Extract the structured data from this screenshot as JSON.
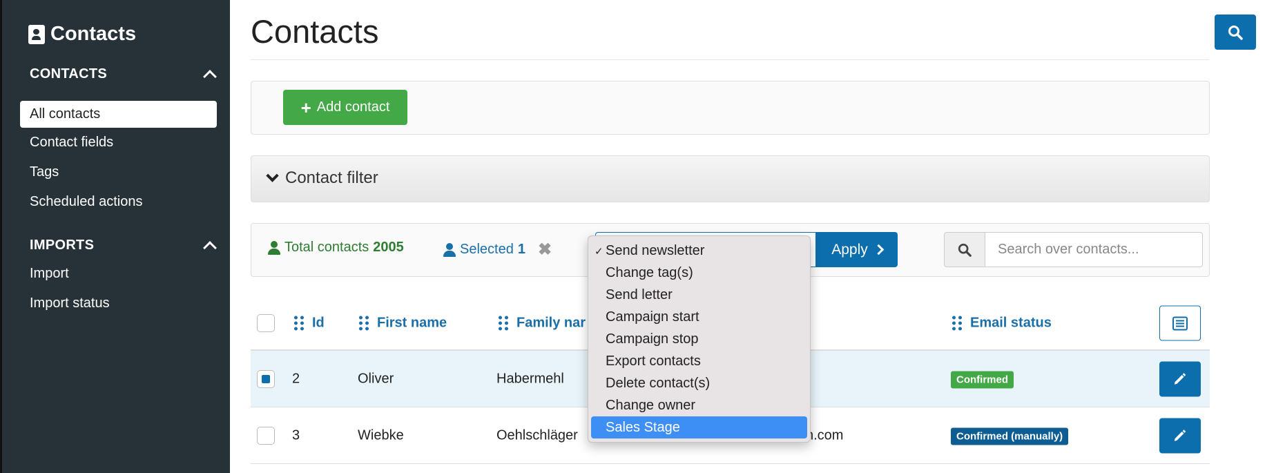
{
  "app": {
    "brand": "Contacts",
    "page_title": "Contacts"
  },
  "sidebar": {
    "sections": [
      {
        "title": "CONTACTS",
        "items": [
          {
            "label": "All contacts",
            "active": true
          },
          {
            "label": "Contact fields",
            "active": false
          },
          {
            "label": "Tags",
            "active": false
          },
          {
            "label": "Scheduled actions",
            "active": false
          }
        ]
      },
      {
        "title": "IMPORTS",
        "items": [
          {
            "label": "Import",
            "active": false
          },
          {
            "label": "Import status",
            "active": false
          }
        ]
      }
    ]
  },
  "toolbar": {
    "add_label": "Add contact",
    "filter_label": "Contact filter"
  },
  "stats": {
    "total_label": "Total contacts",
    "total_value": "2005",
    "selected_label": "Selected",
    "selected_value": "1",
    "clear_glyph": "✖"
  },
  "actions": {
    "apply_label": "Apply",
    "options": [
      {
        "label": "Send newsletter",
        "checked": true,
        "highlighted": false
      },
      {
        "label": "Change tag(s)",
        "checked": false,
        "highlighted": false
      },
      {
        "label": "Send letter",
        "checked": false,
        "highlighted": false
      },
      {
        "label": "Campaign start",
        "checked": false,
        "highlighted": false
      },
      {
        "label": "Campaign stop",
        "checked": false,
        "highlighted": false
      },
      {
        "label": "Export contacts",
        "checked": false,
        "highlighted": false
      },
      {
        "label": "Delete contact(s)",
        "checked": false,
        "highlighted": false
      },
      {
        "label": "Change owner",
        "checked": false,
        "highlighted": false
      },
      {
        "label": "Sales Stage",
        "checked": false,
        "highlighted": true
      }
    ],
    "check_glyph": "✓"
  },
  "search": {
    "placeholder": "Search over contacts..."
  },
  "table": {
    "columns": [
      "Id",
      "First name",
      "Family nar",
      "Email status"
    ],
    "rows": [
      {
        "selected": true,
        "id": "2",
        "first_name": "Oliver",
        "family_name": "Habermehl",
        "email_partial": "",
        "status": "Confirmed",
        "status_color": "#43a946"
      },
      {
        "selected": false,
        "id": "3",
        "first_name": "Wiebke",
        "family_name": "Oehlschläger",
        "email_partial": "n.com",
        "status": "Confirmed (manually)",
        "status_color": "#0d5d92"
      }
    ]
  },
  "colors": {
    "sidebar_bg": "#263238",
    "primary": "#0d6ead",
    "success": "#43a946",
    "highlight": "#3d8ff5"
  }
}
